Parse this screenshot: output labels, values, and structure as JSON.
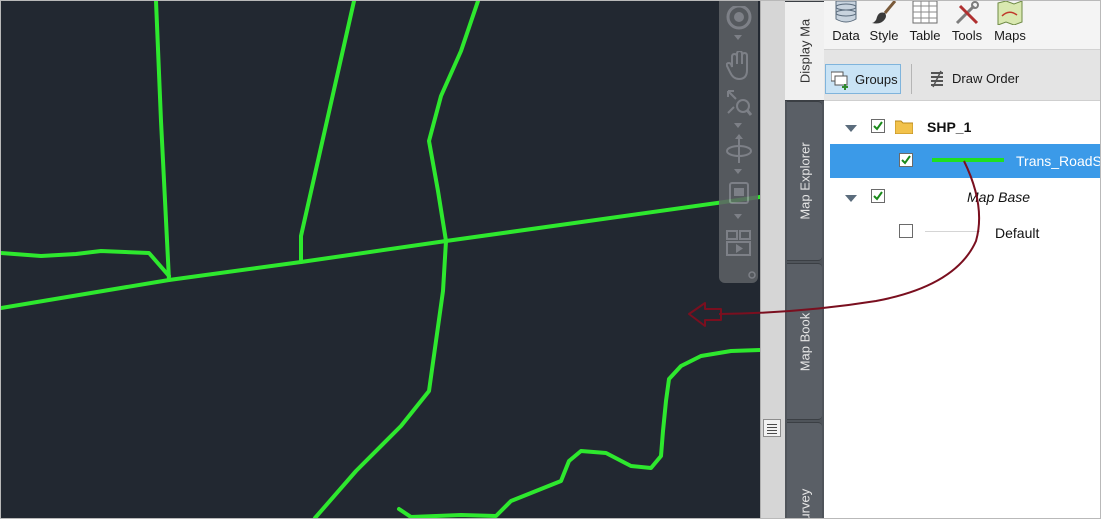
{
  "ribbon": {
    "buttons": [
      {
        "label": "Data",
        "icon": "database-icon"
      },
      {
        "label": "Style",
        "icon": "paintbrush-icon"
      },
      {
        "label": "Table",
        "icon": "table-icon"
      },
      {
        "label": "Tools",
        "icon": "tools-icon"
      },
      {
        "label": "Maps",
        "icon": "maps-icon"
      }
    ]
  },
  "toolbar": {
    "groups_label": "Groups",
    "draw_order_label": "Draw Order"
  },
  "side_tabs": [
    {
      "label": "Display Ma",
      "active": true
    },
    {
      "label": "Map Explorer",
      "active": false
    },
    {
      "label": "Map Book",
      "active": false
    },
    {
      "label": "Survey",
      "active": false
    }
  ],
  "layers": {
    "group1": {
      "name": "SHP_1",
      "checked": true,
      "expanded": true
    },
    "layer1": {
      "name": "Trans_RoadS",
      "checked": true,
      "selected": true,
      "swatch_color": "#1fe01f"
    },
    "group2": {
      "name": "Map Base",
      "checked": true,
      "expanded": true
    },
    "layer2": {
      "name": "Default",
      "checked": false
    }
  },
  "map": {
    "background_color": "#222831",
    "road_color": "#2ee82e",
    "annotation_arrow_color": "#7a0f1f"
  }
}
